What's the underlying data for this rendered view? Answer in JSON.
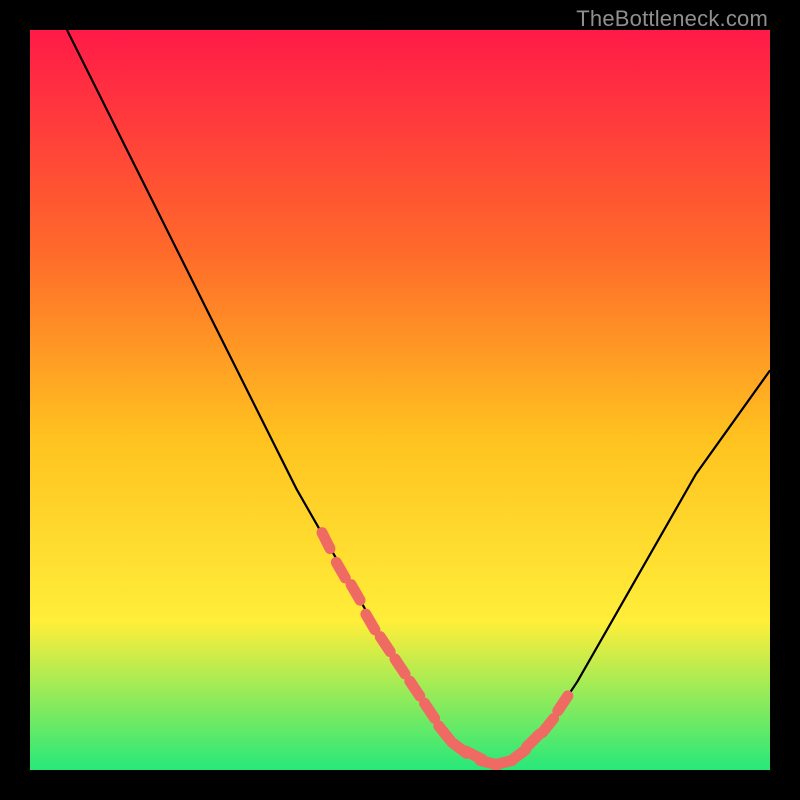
{
  "watermark": "TheBottleneck.com",
  "colors": {
    "background": "#000000",
    "gradient_top": "#ff1a48",
    "gradient_mid1": "#ff6a2a",
    "gradient_mid2": "#ffc21f",
    "gradient_mid3": "#ffee3a",
    "gradient_bottom": "#27e87a",
    "curve": "#000000",
    "marker": "#ef6a63"
  },
  "chart_data": {
    "type": "line",
    "title": "",
    "xlabel": "",
    "ylabel": "",
    "xlim": [
      0,
      100
    ],
    "ylim": [
      0,
      100
    ],
    "series": [
      {
        "name": "bottleneck-curve",
        "x": [
          5,
          8,
          12,
          16,
          20,
          24,
          28,
          32,
          36,
          40,
          44,
          48,
          50,
          52,
          54,
          56,
          58,
          60,
          62,
          66,
          70,
          74,
          78,
          82,
          86,
          90,
          95,
          100
        ],
        "y": [
          100,
          94,
          86,
          78,
          70,
          62,
          54,
          46,
          38,
          31,
          24,
          17,
          14,
          11,
          8,
          5,
          3,
          2,
          1,
          2,
          6,
          12,
          19,
          26,
          33,
          40,
          47,
          54
        ]
      }
    ],
    "markers": {
      "name": "highlighted-points",
      "x": [
        40,
        42,
        44,
        46,
        48,
        50,
        52,
        54,
        56,
        58,
        60,
        62,
        64,
        66,
        68,
        70,
        72
      ],
      "y": [
        31,
        27,
        24,
        20,
        17,
        14,
        11,
        8,
        5,
        3,
        2,
        1,
        1,
        2,
        4,
        6,
        9
      ]
    }
  }
}
